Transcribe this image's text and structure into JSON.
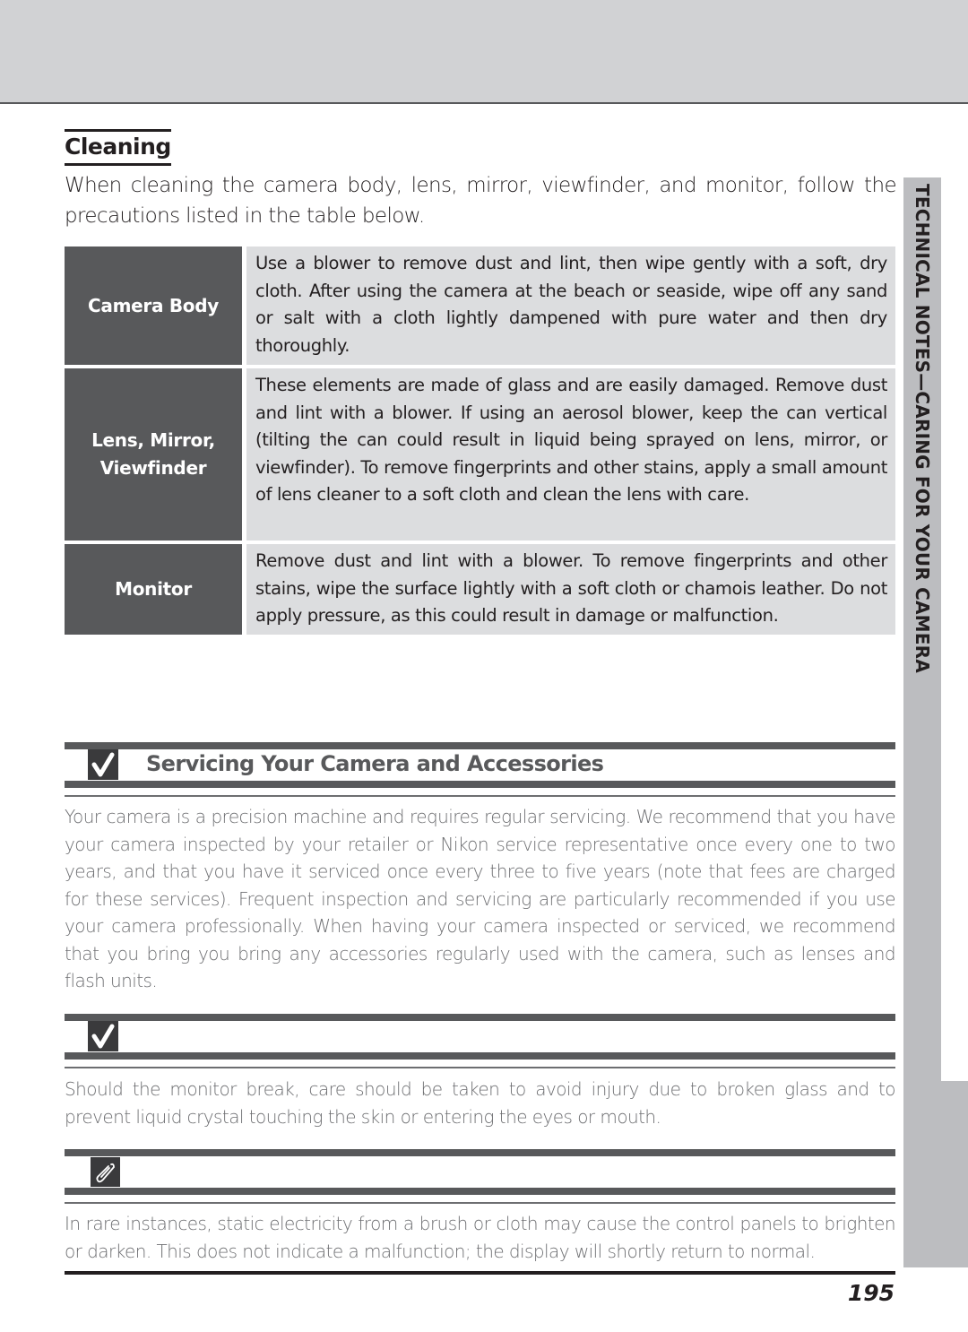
{
  "side_tab": {
    "label": "TECHNICAL NOTES—CARING FOR YOUR CAMERA"
  },
  "cleaning": {
    "title": "Cleaning",
    "intro": "When cleaning the camera body, lens, mirror, viewfinder, and monitor, follow the precautions listed in the table below.",
    "table": [
      {
        "label": "Camera Body",
        "description": "Use a blower to remove dust and lint, then wipe gently with a soft, dry cloth.  After using the camera at the beach or seaside, wipe off any sand or salt with a cloth lightly dampened with pure water and then dry thoroughly."
      },
      {
        "label_line1": "Lens, Mirror,",
        "label_line2": "Viewfinder",
        "description": "These elements are made of glass and are easily damaged.  Remove dust and lint with a blower.  If using an aerosol blower, keep the can vertical (tilting the can could result in liquid being sprayed on lens, mirror, or viewfinder). To remove fingerprints and other stains, apply a small amount of lens cleaner to a soft cloth and clean the lens with care."
      },
      {
        "label": "Monitor",
        "description": "Remove dust and lint with a blower. To remove fingerprints and other stains, wipe the surface lightly with a soft cloth or chamois leather.  Do not apply pressure, as this could result in damage or malfunction."
      }
    ]
  },
  "notes": [
    {
      "icon": "checkmark-icon",
      "title": "Servicing Your Camera and Accessories",
      "body": "Your camera is a precision machine and requires regular servicing.  We recommend that you have your camera inspected by your retailer or Nikon service representative once every one to two years, and that you have it serviced once every three to five years (note that fees are charged for these services).  Frequent inspection and servicing are particularly recommended if you use your camera professionally.  When having your camera inspected or serviced, we recommend that you bring you bring any accessories regularly used with the camera, such as lenses and flash units."
    },
    {
      "icon": "checkmark-icon",
      "title": "",
      "body": "Should the monitor break, care should be taken to avoid injury due to broken glass and to prevent liquid crystal touching the skin or entering the eyes or mouth."
    },
    {
      "icon": "paperclip-icon",
      "title": "",
      "body": "In rare instances, static electricity from a brush or cloth may cause the control panels to brighten or darken.  This does not indicate a malfunction; the display will shortly return to normal."
    }
  ],
  "page_number": "195"
}
